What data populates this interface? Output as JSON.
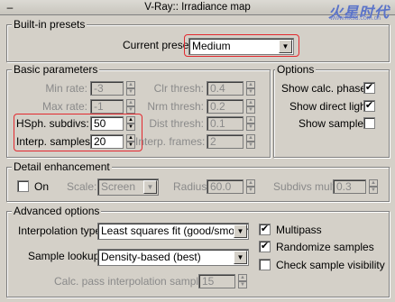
{
  "titlebar": {
    "toggle": "–",
    "title": "V-Ray:: Irradiance map"
  },
  "watermark": {
    "text": "火星时代",
    "url": "www.hxsd.com.cn"
  },
  "builtin": {
    "group_title": "Built-in presets",
    "preset_label": "Current preset:",
    "preset_value": "Medium"
  },
  "basic": {
    "group_title": "Basic parameters",
    "min_rate_label": "Min rate:",
    "min_rate_value": "-3",
    "max_rate_label": "Max rate:",
    "max_rate_value": "-1",
    "hsph_label": "HSph. subdivs:",
    "hsph_value": "50",
    "interp_label": "Interp. samples:",
    "interp_value": "20",
    "clr_label": "Clr thresh:",
    "clr_value": "0.4",
    "nrm_label": "Nrm thresh:",
    "nrm_value": "0.2",
    "dist_label": "Dist thresh:",
    "dist_value": "0.1",
    "frames_label": "Interp. frames:",
    "frames_value": "2"
  },
  "options": {
    "group_title": "Options",
    "calc_phase_label": "Show calc. phase",
    "calc_phase_checked": true,
    "direct_light_label": "Show direct light",
    "direct_light_checked": true,
    "samples_label": "Show samples",
    "samples_checked": false
  },
  "detail": {
    "group_title": "Detail enhancement",
    "on_label": "On",
    "on_checked": false,
    "scale_label": "Scale:",
    "scale_value": "Screen",
    "radius_label": "Radius:",
    "radius_value": "60.0",
    "subdivs_label": "Subdivs mult.",
    "subdivs_value": "0.3"
  },
  "advanced": {
    "group_title": "Advanced options",
    "interp_type_label": "Interpolation type:",
    "interp_type_value": "Least squares fit (good/smooth",
    "lookup_label": "Sample lookup:",
    "lookup_value": "Density-based (best)",
    "calc_pass_label": "Calc. pass interpolation samples:",
    "calc_pass_value": "15",
    "multipass_label": "Multipass",
    "multipass_checked": true,
    "randomize_label": "Randomize samples",
    "randomize_checked": true,
    "visibility_label": "Check sample visibility",
    "visibility_checked": false
  },
  "glyphs": {
    "check": "✔",
    "arrow_down": "▼",
    "arrow_up": "▲"
  },
  "colors": {
    "panel": "#d4d0c8",
    "highlight": "#e3292f",
    "disabled_text": "#8a8a8a"
  }
}
